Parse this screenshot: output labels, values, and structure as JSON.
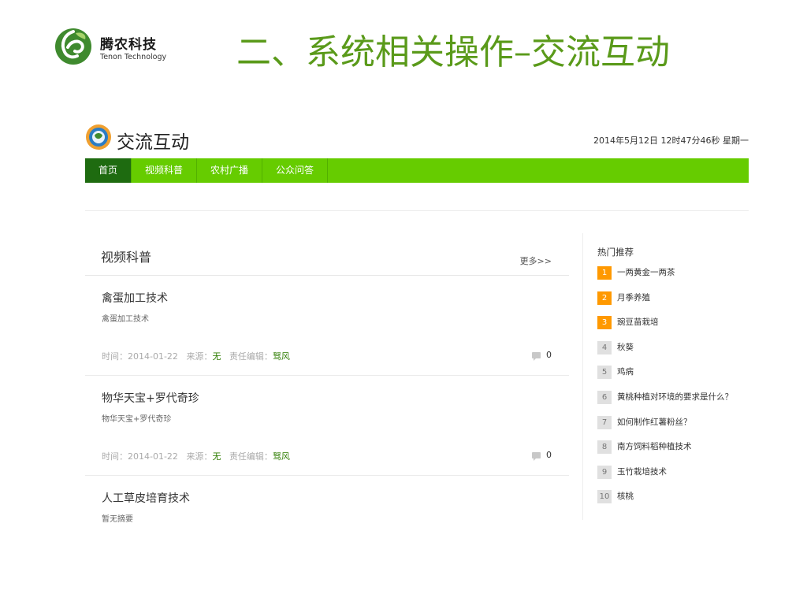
{
  "slide": {
    "brand_cn": "腾农科技",
    "brand_en": "Tenon Technology",
    "title": "二、系统相关操作–交流互动"
  },
  "site": {
    "name": "交流互动",
    "datetime": "2014年5月12日 12时47分46秒  星期一",
    "nav": [
      {
        "label": "首页",
        "active": true
      },
      {
        "label": "视频科普"
      },
      {
        "label": "农村广播"
      },
      {
        "label": "公众问答"
      }
    ]
  },
  "main": {
    "section_title": "视频科普",
    "more": "更多>>",
    "articles": [
      {
        "title": "禽蛋加工技术",
        "summary": "禽蛋加工技术",
        "time": "时间：2014-01-22",
        "source_label": "来源：",
        "source": "无",
        "editor_label": "责任编辑：",
        "editor": "驽风",
        "comments": "0"
      },
      {
        "title": "物华天宝+罗代奇珍",
        "summary": "物华天宝+罗代奇珍",
        "time": "时间：2014-01-22",
        "source_label": "来源：",
        "source": "无",
        "editor_label": "责任编辑：",
        "editor": "驽风",
        "comments": "0"
      },
      {
        "title": "人工草皮培育技术",
        "summary": "暂无摘要"
      }
    ]
  },
  "sidebar": {
    "title": "热门推荐",
    "items": [
      {
        "rank": "1",
        "text": "一两黄金一两茶"
      },
      {
        "rank": "2",
        "text": "月季养殖"
      },
      {
        "rank": "3",
        "text": "豌豆苗栽培"
      },
      {
        "rank": "4",
        "text": "秋葵"
      },
      {
        "rank": "5",
        "text": "鸡病"
      },
      {
        "rank": "6",
        "text": "黄桃种植对环境的要求是什么？"
      },
      {
        "rank": "7",
        "text": "如何制作红薯粉丝？"
      },
      {
        "rank": "8",
        "text": "南方饲料稻种植技术"
      },
      {
        "rank": "9",
        "text": "玉竹栽培技术"
      },
      {
        "rank": "10",
        "text": "核桃"
      }
    ]
  },
  "colors": {
    "nav_bg": "#66cc00",
    "nav_active": "#1e6b10",
    "title_green": "#5a9a1a",
    "rank_top": "#ff9900"
  }
}
